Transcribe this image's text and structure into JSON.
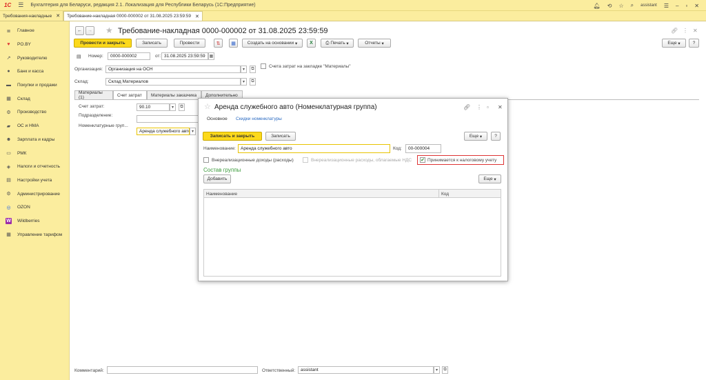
{
  "app": {
    "logo": "1С",
    "title": "Бухгалтерия для Беларуси, редакция 2.1. Локализация для Республики Беларусь   (1С:Предприятие)",
    "user": "assistant"
  },
  "open_tabs": [
    {
      "label": "Требования-накладные"
    },
    {
      "label": "Требование-накладная 0000-000002 от 31.08.2025 23:59:59"
    }
  ],
  "sidebar": {
    "items": [
      {
        "label": "Главное",
        "icon": "≣"
      },
      {
        "label": "PO.BY",
        "icon": "♥"
      },
      {
        "label": "Руководителю",
        "icon": "↗"
      },
      {
        "label": "Банк и касса",
        "icon": "●"
      },
      {
        "label": "Покупки и продажи",
        "icon": "▬"
      },
      {
        "label": "Склад",
        "icon": "▦"
      },
      {
        "label": "Производство",
        "icon": "⚙"
      },
      {
        "label": "ОС и НМА",
        "icon": "▰"
      },
      {
        "label": "Зарплата и кадры",
        "icon": "☻"
      },
      {
        "label": "РМК",
        "icon": "▭"
      },
      {
        "label": "Налоги и отчетность",
        "icon": "◈"
      },
      {
        "label": "Настройки учета",
        "icon": "▤"
      },
      {
        "label": "Администрирование",
        "icon": "⚙"
      },
      {
        "label": "OZON",
        "icon": "◎"
      },
      {
        "label": "Wildberries",
        "icon": "W"
      },
      {
        "label": "Управление тарифом",
        "icon": "▦"
      }
    ]
  },
  "doc": {
    "title": "Требование-накладная 0000-000002 от 31.08.2025 23:59:59",
    "btn_post_close": "Провести и закрыть",
    "btn_save": "Записать",
    "btn_post": "Провести",
    "btn_create_based": "Создать на основании",
    "btn_print": "Печать",
    "btn_reports": "Отчеты",
    "btn_more": "Еще",
    "btn_help": "?",
    "number_label": "Номер:",
    "number_value": "0000-000002",
    "date_label": "от:",
    "date_value": "31.08.2025 23:59:59",
    "org_label": "Организация:",
    "org_value": "Организация на ОСН",
    "cost_accounts_label": "Счета затрат на закладке \"Материалы\"",
    "warehouse_label": "Склад:",
    "warehouse_value": "Склад Материалов",
    "tabs": [
      "Материалы (1)",
      "Счет затрат",
      "Материалы заказчика",
      "Дополнительно"
    ],
    "cost_account_label": "Счет затрат:",
    "cost_account_value": "90.10",
    "division_label": "Подразделение:",
    "nomgroup_label": "Номенклатурные груп...",
    "nomgroup_value": "Аренда служебного авто",
    "comment_label": "Комментарий:",
    "responsible_label": "Ответственный:",
    "responsible_value": "assistant"
  },
  "dialog": {
    "title": "Аренда служебного авто (Номенклатурная группа)",
    "tab_main": "Основное",
    "tab_discounts": "Скидки номенклатуры",
    "btn_save_close": "Записать и закрыть",
    "btn_save": "Записать",
    "btn_more": "Еще",
    "btn_help": "?",
    "name_label": "Наименование:",
    "name_value": "Аренда служебного авто",
    "code_label": "Код:",
    "code_value": "00-000004",
    "chk_nonop": "Внереализационные доходы (расходы)",
    "chk_nonop_vat": "Внереализационные расходы, облагаемые НДС",
    "chk_tax": "Принимается к налоговому учету",
    "group_title": "Состав группы",
    "btn_add": "Добавить",
    "btn_more2": "Еще",
    "col_name": "Наименование",
    "col_code": "Код"
  },
  "colors": {
    "panel": "#fbed9e",
    "primary_button": "#fcd91b",
    "section_green": "#3a9a3a",
    "highlight_red": "#dd3333"
  }
}
